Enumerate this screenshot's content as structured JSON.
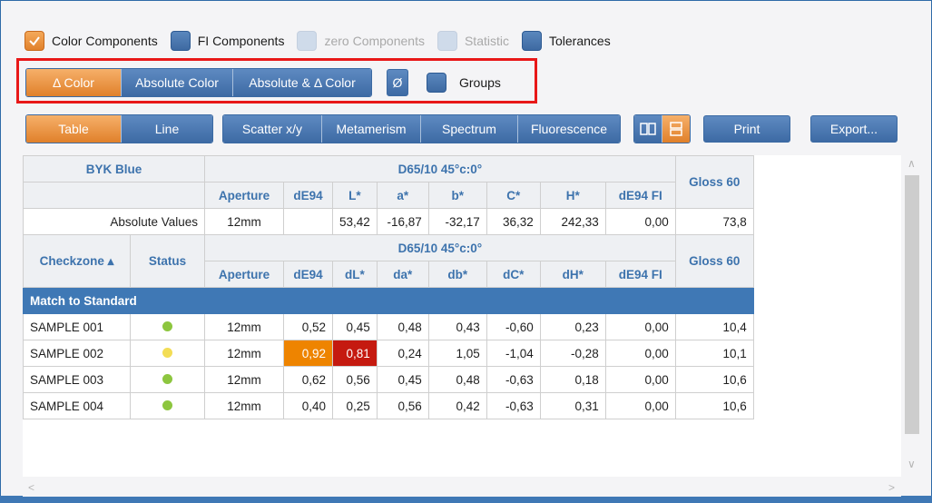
{
  "options_row": [
    {
      "label": "Color Components",
      "state": "checked"
    },
    {
      "label": "FI Components",
      "state": "unchecked"
    },
    {
      "label": "zero Components",
      "state": "disabled"
    },
    {
      "label": "Statistic",
      "state": "disabled"
    },
    {
      "label": "Tolerances",
      "state": "unchecked"
    }
  ],
  "mode_row": {
    "segments": [
      "Δ Color",
      "Absolute Color",
      "Absolute & Δ Color"
    ],
    "active_segment": "Δ Color",
    "avg_button": "Ø",
    "groups_label": "Groups"
  },
  "view_row": {
    "tabs": [
      "Table",
      "Line",
      "Scatter x/y",
      "Metamerism",
      "Spectrum",
      "Fluorescence"
    ],
    "active_tab": "Table",
    "print_label": "Print",
    "export_label": "Export..."
  },
  "table": {
    "standard_name": "BYK Blue",
    "geometry_label": "D65/10  45°c:0°",
    "gloss_label": "Gloss 60",
    "abs_headers": [
      "Aperture",
      "dE94",
      "L*",
      "a*",
      "b*",
      "C*",
      "H*",
      "dE94 FI"
    ],
    "abs_row_label": "Absolute Values",
    "abs_row": [
      "12mm",
      "",
      "53,42",
      "-16,87",
      "-32,17",
      "36,32",
      "242,33",
      "0,00",
      "73,8"
    ],
    "checkzone_label": "Checkzone ▴",
    "status_label": "Status",
    "delta_headers": [
      "Aperture",
      "dE94",
      "dL*",
      "da*",
      "db*",
      "dC*",
      "dH*",
      "dE94 FI"
    ],
    "group_label": "Match to Standard",
    "rows": [
      {
        "name": "SAMPLE 001",
        "status": "#8dc63f",
        "aperture": "12mm",
        "dE94": "0,52",
        "dL": "0,45",
        "da": "0,48",
        "db": "0,43",
        "dC": "-0,60",
        "dH": "0,23",
        "dE94FI": "0,00",
        "gloss": "10,4",
        "highlight": []
      },
      {
        "name": "SAMPLE 002",
        "status": "#f3dd55",
        "aperture": "12mm",
        "dE94": "0,92",
        "dL": "0,81",
        "da": "0,24",
        "db": "1,05",
        "dC": "-1,04",
        "dH": "-0,28",
        "dE94FI": "0,00",
        "gloss": "10,1",
        "highlight": [
          "dE94",
          "dL"
        ]
      },
      {
        "name": "SAMPLE 003",
        "status": "#8dc63f",
        "aperture": "12mm",
        "dE94": "0,62",
        "dL": "0,56",
        "da": "0,45",
        "db": "0,48",
        "dC": "-0,63",
        "dH": "0,18",
        "dE94FI": "0,00",
        "gloss": "10,6",
        "highlight": []
      },
      {
        "name": "SAMPLE 004",
        "status": "#8dc63f",
        "aperture": "12mm",
        "dE94": "0,40",
        "dL": "0,25",
        "da": "0,56",
        "db": "0,42",
        "dC": "-0,63",
        "dH": "0,31",
        "dE94FI": "0,00",
        "gloss": "10,6",
        "highlight": []
      }
    ]
  },
  "colors": {
    "accent_orange": "#e0802a",
    "accent_blue": "#3f78b5",
    "highlight_box": "#e81818",
    "warn_orange": "#ee8400",
    "fail_red": "#c51a10"
  }
}
